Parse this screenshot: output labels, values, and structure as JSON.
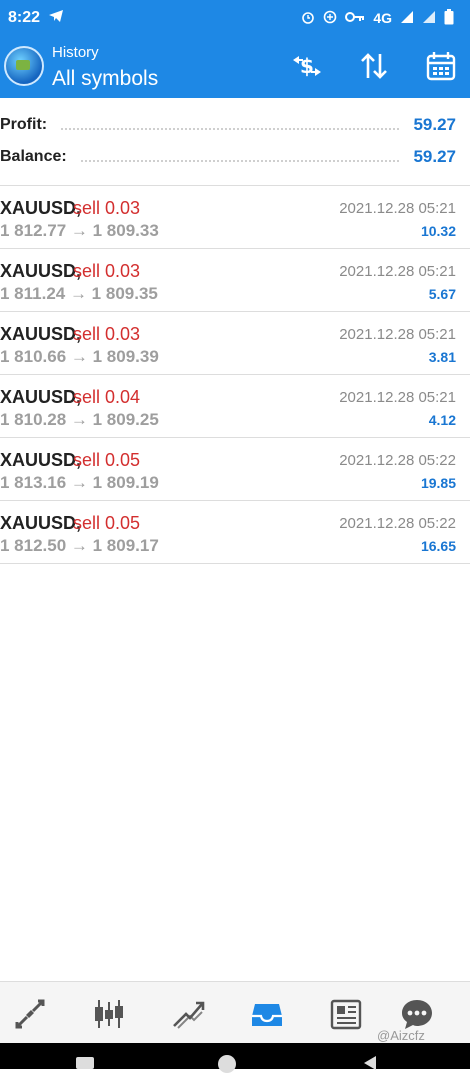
{
  "status_bar": {
    "time": "8:22",
    "network": "4G"
  },
  "header": {
    "subtitle": "History",
    "title": "All symbols"
  },
  "summary": {
    "profit_label": "Profit:",
    "profit_value": "59.27",
    "balance_label": "Balance:",
    "balance_value": "59.27"
  },
  "trades": [
    {
      "symbol": "XAUUSD,",
      "side": "sell 0.03",
      "prices": "1 812.77 → 1 809.33",
      "datetime": "2021.12.28 05:21",
      "profit": "10.32"
    },
    {
      "symbol": "XAUUSD,",
      "side": "sell 0.03",
      "prices": "1 811.24 → 1 809.35",
      "datetime": "2021.12.28 05:21",
      "profit": "5.67"
    },
    {
      "symbol": "XAUUSD,",
      "side": "sell 0.03",
      "prices": "1 810.66 → 1 809.39",
      "datetime": "2021.12.28 05:21",
      "profit": "3.81"
    },
    {
      "symbol": "XAUUSD,",
      "side": "sell 0.04",
      "prices": "1 810.28 → 1 809.25",
      "datetime": "2021.12.28 05:21",
      "profit": "4.12"
    },
    {
      "symbol": "XAUUSD,",
      "side": "sell 0.05",
      "prices": "1 813.16 → 1 809.19",
      "datetime": "2021.12.28 05:22",
      "profit": "19.85"
    },
    {
      "symbol": "XAUUSD,",
      "side": "sell 0.05",
      "prices": "1 812.50 → 1 809.17",
      "datetime": "2021.12.28 05:22",
      "profit": "16.65"
    }
  ],
  "watermark": "@Aizcfz",
  "icons": {
    "toolbar": [
      "currency-exchange-icon",
      "sort-icon",
      "calendar-icon"
    ],
    "bottom_nav": [
      "quotes-icon",
      "chart-icon",
      "trade-icon",
      "history-icon",
      "news-icon",
      "chat-icon"
    ]
  },
  "colors": {
    "accent": "#1e88e5",
    "sell": "#d32f2f",
    "profit": "#1976d2"
  }
}
